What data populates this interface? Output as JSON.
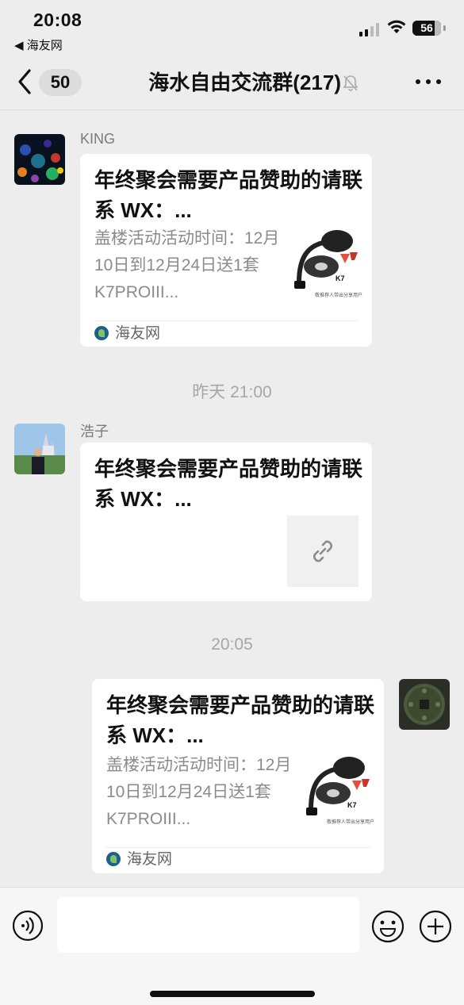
{
  "status_bar": {
    "time": "20:08",
    "back_app": "◀ 海友网",
    "battery": "56"
  },
  "nav": {
    "unread_count": "50",
    "title": "海水自由交流群(217)"
  },
  "messages": [
    {
      "sender": "KING",
      "card": {
        "title": "年终聚会需要产品赞助的请联系 WX：...",
        "desc": "盖楼活动活动时间：12月10日到12月24日送1套 K7PROIII...",
        "thumb_brand": "K7",
        "thumb_caption": "敬推荐人带出分享用户",
        "source": "海友网"
      }
    },
    {
      "timestamp": "昨天 21:00"
    },
    {
      "sender": "浩子",
      "card": {
        "title": "年终聚会需要产品赞助的请联系 WX：...",
        "thumb_icon": "link-icon"
      }
    },
    {
      "timestamp": "20:05"
    },
    {
      "sender": "self",
      "card": {
        "title": "年终聚会需要产品赞助的请联系 WX：...",
        "desc": "盖楼活动活动时间：12月10日到12月24日送1套 K7PROIII...",
        "thumb_brand": "K7",
        "thumb_caption": "敬推荐人带出分享用户",
        "source": "海友网"
      }
    }
  ],
  "input": {
    "value": ""
  },
  "icons": [
    "chevron-left-icon",
    "bell-slash-icon",
    "more-icon",
    "voice-icon",
    "emoji-icon",
    "plus-icon",
    "link-icon"
  ],
  "colors": {
    "background": "#ededed",
    "bubble": "#ffffff",
    "source_icon": "#1f5f8b"
  }
}
